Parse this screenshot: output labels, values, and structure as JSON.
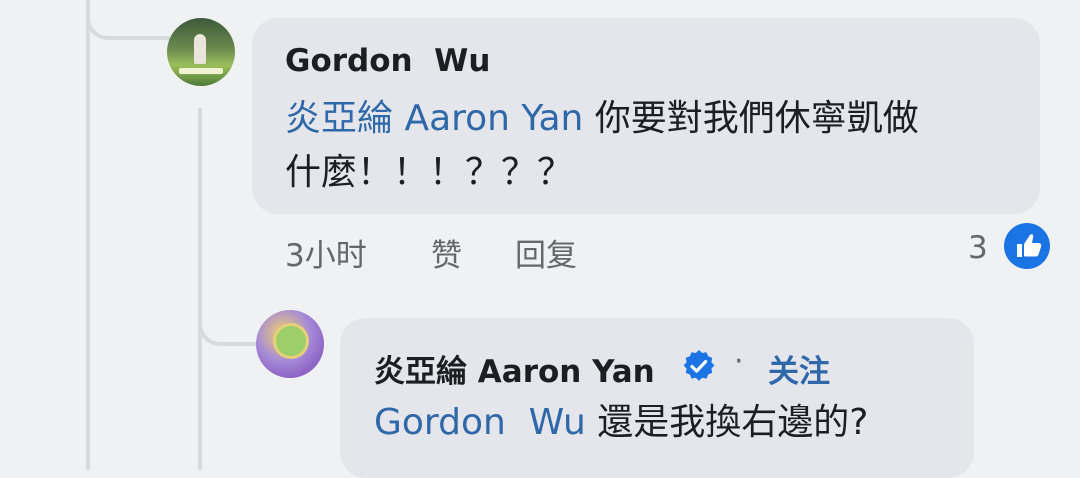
{
  "comment": {
    "author": "Gordon  Wu",
    "text_line1": [
      {
        "kind": "mention",
        "text": "炎亞綸 Aaron Yan"
      },
      {
        "kind": "plain",
        "text": " 你要對我們休寧凱做"
      }
    ],
    "text_line2": "什麼！！！？？？",
    "time": "3小时",
    "like_label": "赞",
    "reply_label": "回复",
    "reaction_count": "3",
    "avatar_icon": "user-avatar-photo"
  },
  "reply": {
    "author": "炎亞綸 Aaron Yan",
    "verified_icon": "verified-badge-icon",
    "separator": "·",
    "follow_label": "关注",
    "mention": "Gordon  Wu",
    "text": " 還是我換右邊的?",
    "avatar_icon": "user-avatar-illustration"
  },
  "colors": {
    "mention": "#2e68a8",
    "like_icon": "#1b74e4",
    "bubble": "#e4e6eb",
    "background": "#f0f1f3"
  }
}
